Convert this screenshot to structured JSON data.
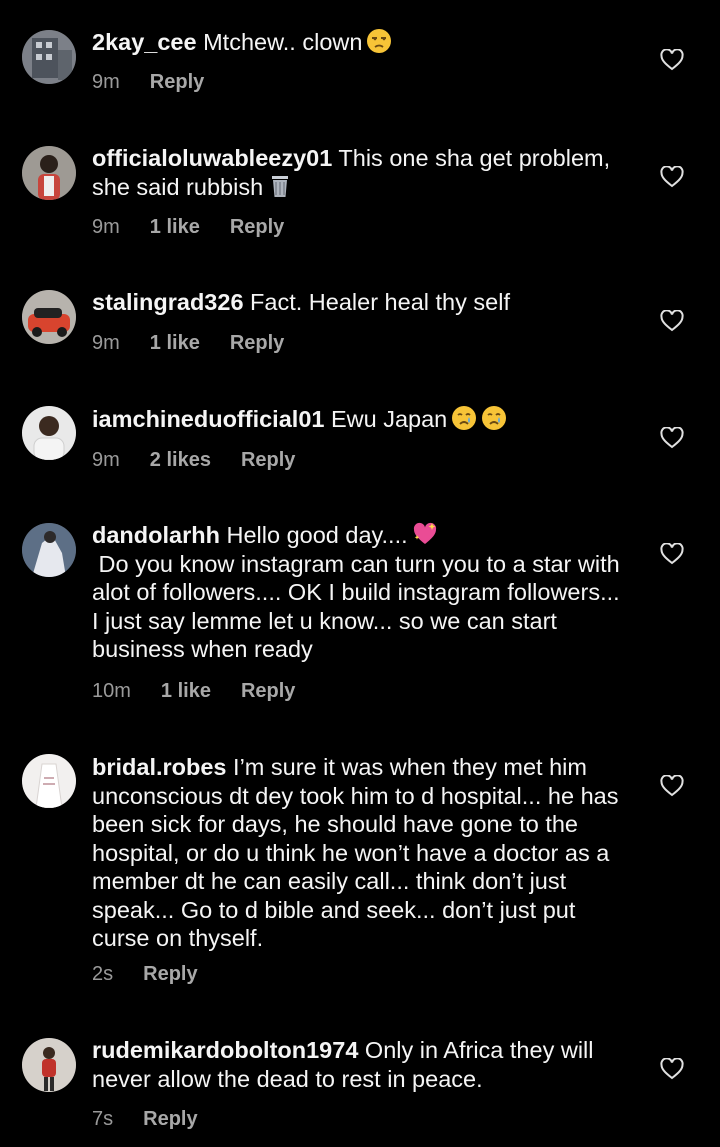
{
  "comments": [
    {
      "username": "2kay_cee",
      "text": " Mtchew.. clown",
      "emoji": [
        "unamused-face-emoji"
      ],
      "time": "9m",
      "likes": "",
      "reply": "Reply"
    },
    {
      "username": "officialoluwableezy01",
      "text": " This one sha get problem,  she said rubbish",
      "emoji": [
        "wastebasket-emoji"
      ],
      "time": "9m",
      "likes": "1 like",
      "reply": "Reply"
    },
    {
      "username": "stalingrad326",
      "text": " Fact. Healer heal thy self",
      "emoji": [],
      "time": "9m",
      "likes": "1 like",
      "reply": "Reply"
    },
    {
      "username": "iamchineduofficial01",
      "text": " Ewu Japan",
      "emoji": [
        "crying-face-emoji",
        "crying-face-emoji"
      ],
      "time": "9m",
      "likes": "2 likes",
      "reply": "Reply"
    },
    {
      "username": "dandolarhh",
      "text": " Hello good day....",
      "text2": " Do you know instagram can turn you to a star with alot of followers.... OK I build instagram followers... I just say lemme let u know... so we can start business when ready",
      "emoji": [
        "sparkling-heart-emoji"
      ],
      "time": "10m",
      "likes": "1 like",
      "reply": "Reply"
    },
    {
      "username": "bridal.robes",
      "text": " I’m sure it was when they met him unconscious dt dey took him to d hospital... he has been sick for days, he should have gone to the hospital, or do u think he won’t have a doctor as a member dt he can easily call... think don’t just speak... Go to d bible and seek... don’t just put curse on thyself.",
      "emoji": [],
      "time": "2s",
      "likes": "",
      "reply": "Reply"
    },
    {
      "username": "rudemikardobolton1974",
      "text": " Only in Africa they will never allow the dead to rest in peace.",
      "emoji": [],
      "time": "7s",
      "likes": "",
      "reply": "Reply"
    }
  ],
  "colors": {
    "background": "#000000",
    "text": "#f5f5f5",
    "meta": "#9a9a9a",
    "heart_outline": "#e0e0e0"
  },
  "icons": {
    "like": "heart-outline-icon"
  }
}
